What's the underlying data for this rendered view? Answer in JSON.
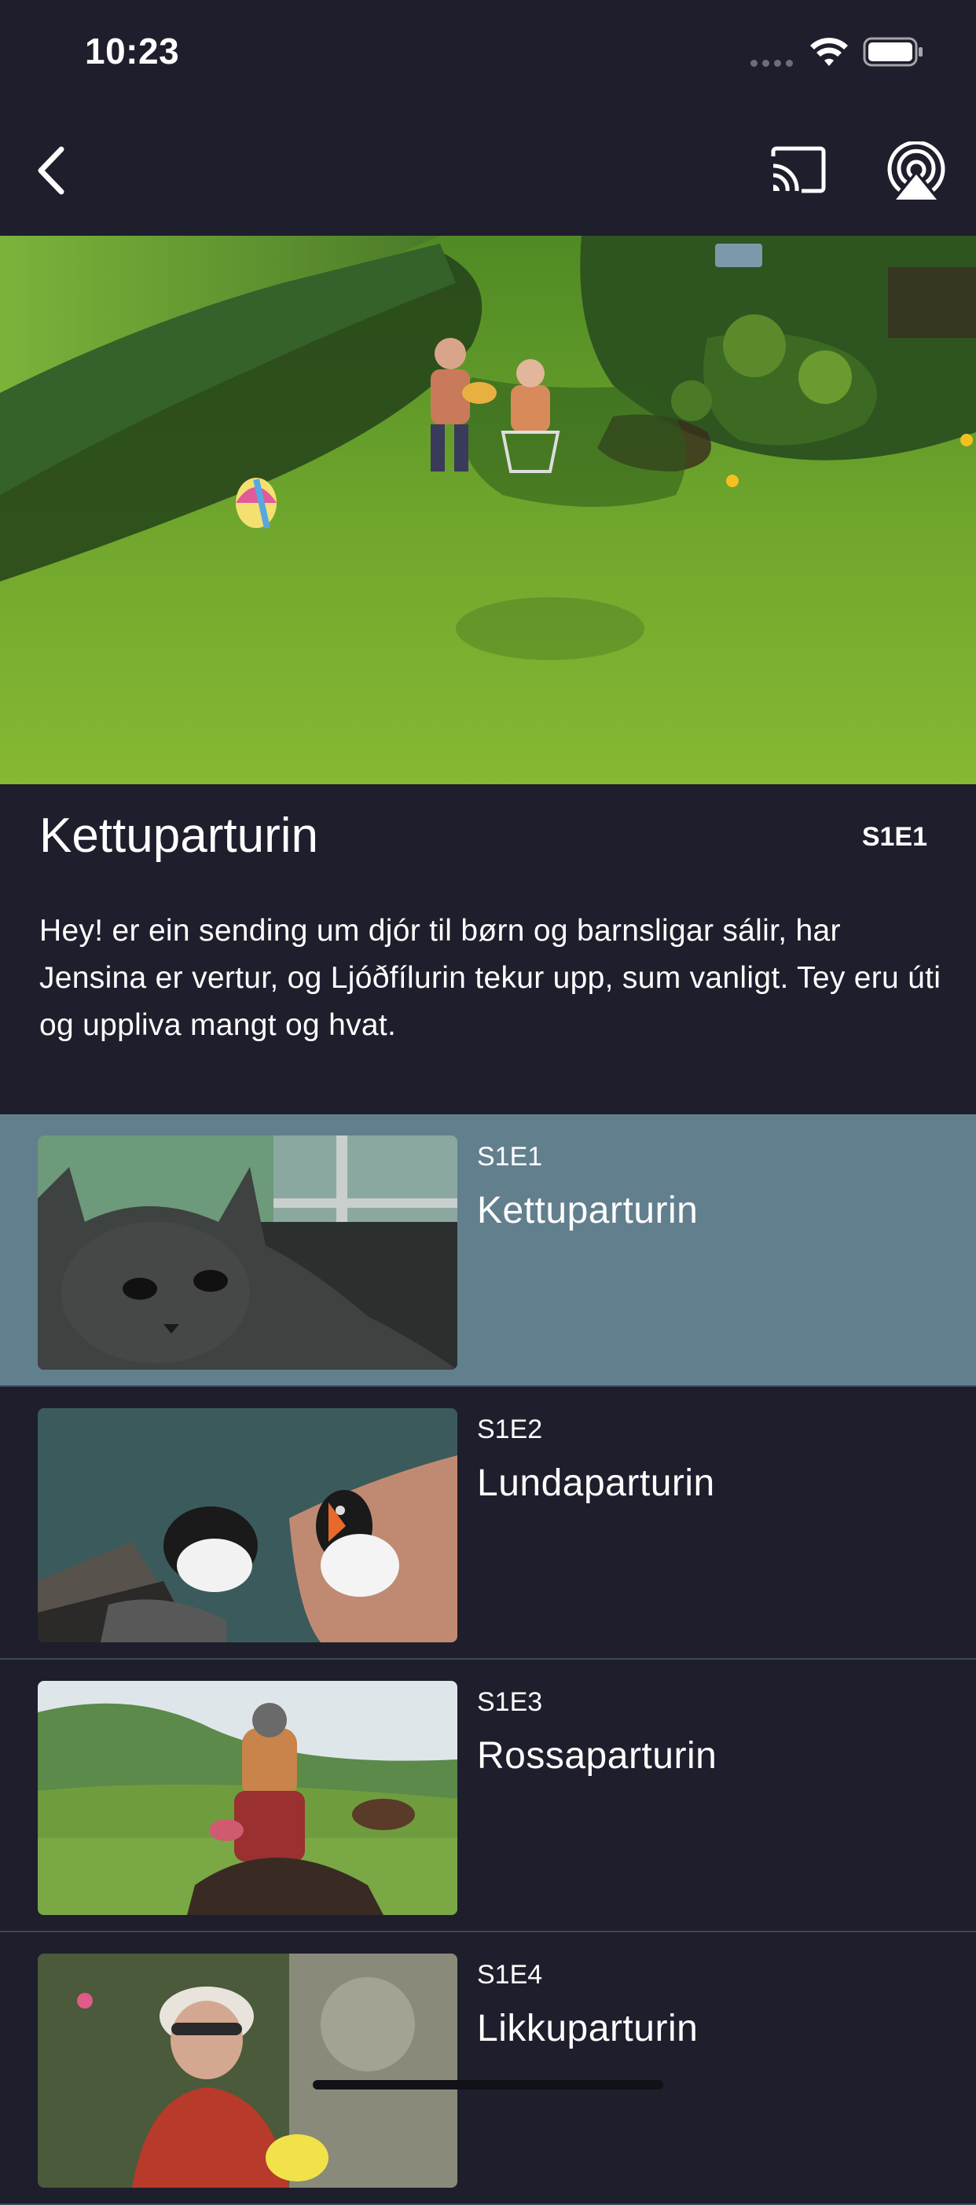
{
  "status_bar": {
    "time": "10:23"
  },
  "nav": {
    "back_icon": "chevron-left-icon",
    "cast_icon": "cast-icon",
    "airplay_icon": "airplay-icon"
  },
  "episode": {
    "title": "Kettuparturin",
    "code": "S1E1",
    "description": "Hey! er ein sending um djór til børn og barnsligar sálir, har Jensina er vertur, og Ljóðfílurin tekur upp, sum vanligt. Tey eru úti og uppliva mangt og hvat."
  },
  "episodes": [
    {
      "code": "S1E1",
      "title": "Kettuparturin",
      "selected": true
    },
    {
      "code": "S1E2",
      "title": "Lundaparturin",
      "selected": false
    },
    {
      "code": "S1E3",
      "title": "Rossaparturin",
      "selected": false
    },
    {
      "code": "S1E4",
      "title": "Likkuparturin",
      "selected": false
    }
  ],
  "colors": {
    "background": "#1e1e2c",
    "selected_row": "#627f8e",
    "divider": "#3a4a58"
  }
}
